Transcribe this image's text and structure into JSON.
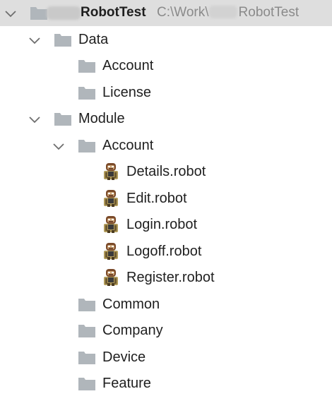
{
  "project": {
    "name": "RobotTest",
    "path_prefix": "C:\\Work\\",
    "path_suffix": "RobotTest"
  },
  "tree": [
    {
      "label": "Data",
      "type": "folder",
      "level": 1,
      "expanded": true
    },
    {
      "label": "Account",
      "type": "folder",
      "level": 2,
      "expanded": false
    },
    {
      "label": "License",
      "type": "folder",
      "level": 2,
      "expanded": false
    },
    {
      "label": "Module",
      "type": "folder",
      "level": 1,
      "expanded": true
    },
    {
      "label": "Account",
      "type": "folder",
      "level": 2,
      "expanded": true
    },
    {
      "label": "Details.robot",
      "type": "robot",
      "level": 3
    },
    {
      "label": "Edit.robot",
      "type": "robot",
      "level": 3
    },
    {
      "label": "Login.robot",
      "type": "robot",
      "level": 3
    },
    {
      "label": "Logoff.robot",
      "type": "robot",
      "level": 3
    },
    {
      "label": "Register.robot",
      "type": "robot",
      "level": 3
    },
    {
      "label": "Common",
      "type": "folder",
      "level": 2,
      "expanded": false
    },
    {
      "label": "Company",
      "type": "folder",
      "level": 2,
      "expanded": false
    },
    {
      "label": "Device",
      "type": "folder",
      "level": 2,
      "expanded": false
    },
    {
      "label": "Feature",
      "type": "folder",
      "level": 2,
      "expanded": false
    }
  ],
  "colors": {
    "folder": "#b0b6bb",
    "chevron": "#6e6e6e",
    "selected_row": "#dedede",
    "path_text": "#8a8a8a"
  },
  "icons": {
    "expanded": "chevron-down-icon",
    "folder": "folder-icon",
    "robot": "robot-file-icon"
  }
}
